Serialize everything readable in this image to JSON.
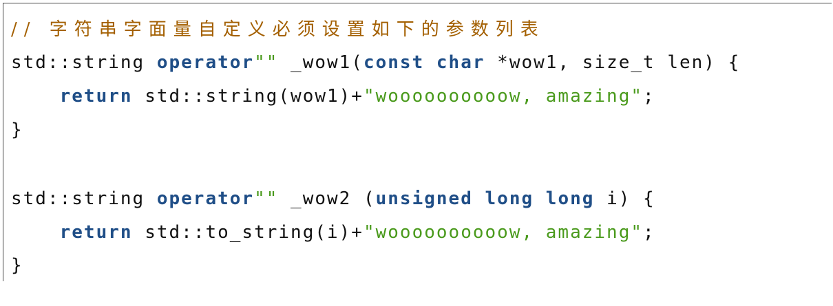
{
  "colors": {
    "comment": "#a35f00",
    "keyword": "#1f4e87",
    "string": "#4a9a1c",
    "text": "#111111"
  },
  "code": {
    "lines": [
      [
        {
          "t": "// 字符串字面量自定义必须设置如下的参数列表",
          "c": "comment"
        }
      ],
      [
        {
          "t": "std::string ",
          "c": "text"
        },
        {
          "t": "operator",
          "c": "keyword"
        },
        {
          "t": "\"\"",
          "c": "string"
        },
        {
          "t": " _wow1(",
          "c": "text"
        },
        {
          "t": "const",
          "c": "keyword"
        },
        {
          "t": " ",
          "c": "text"
        },
        {
          "t": "char",
          "c": "keyword"
        },
        {
          "t": " *wow1, size_t len) {",
          "c": "text"
        }
      ],
      [
        {
          "t": "    ",
          "c": "text"
        },
        {
          "t": "return",
          "c": "keyword"
        },
        {
          "t": " std::string(wow1)+",
          "c": "text"
        },
        {
          "t": "\"woooooooooow, amazing\"",
          "c": "string"
        },
        {
          "t": ";",
          "c": "text"
        }
      ],
      [
        {
          "t": "}",
          "c": "text"
        }
      ],
      [],
      [
        {
          "t": "std::string ",
          "c": "text"
        },
        {
          "t": "operator",
          "c": "keyword"
        },
        {
          "t": "\"\"",
          "c": "string"
        },
        {
          "t": " _wow2 (",
          "c": "text"
        },
        {
          "t": "unsigned",
          "c": "keyword"
        },
        {
          "t": " ",
          "c": "text"
        },
        {
          "t": "long",
          "c": "keyword"
        },
        {
          "t": " ",
          "c": "text"
        },
        {
          "t": "long",
          "c": "keyword"
        },
        {
          "t": " i) {",
          "c": "text"
        }
      ],
      [
        {
          "t": "    ",
          "c": "text"
        },
        {
          "t": "return",
          "c": "keyword"
        },
        {
          "t": " std::to_string(i)+",
          "c": "text"
        },
        {
          "t": "\"woooooooooow, amazing\"",
          "c": "string"
        },
        {
          "t": ";",
          "c": "text"
        }
      ],
      [
        {
          "t": "}",
          "c": "text"
        }
      ]
    ]
  }
}
